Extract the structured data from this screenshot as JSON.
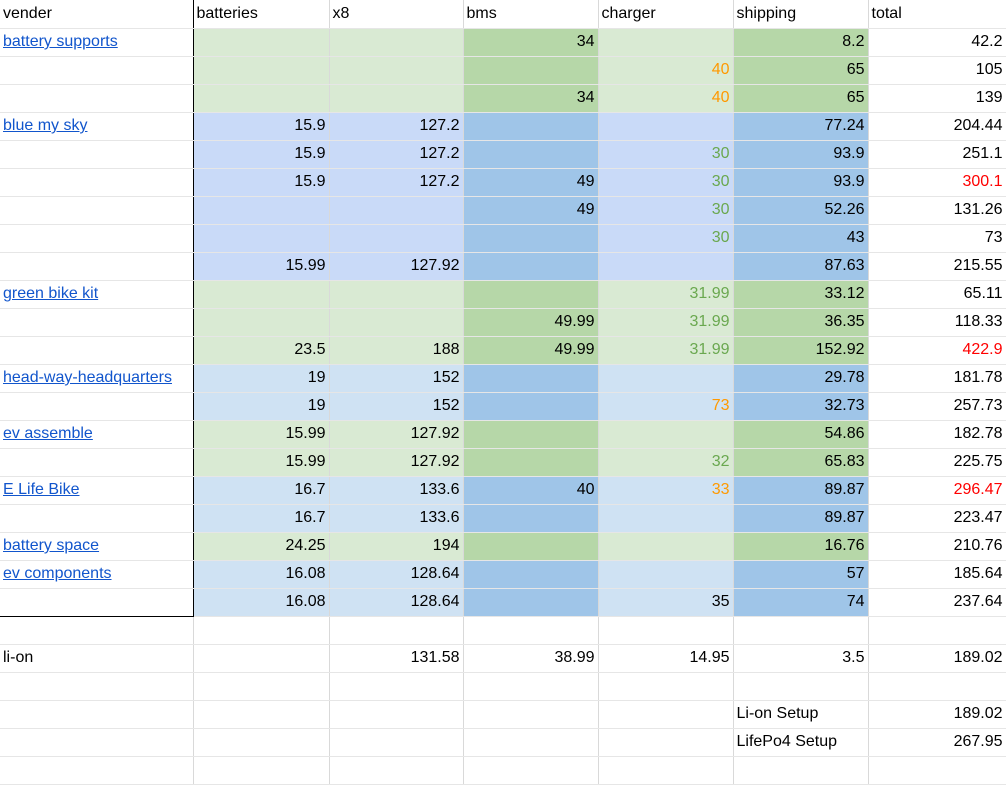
{
  "header": [
    "vender",
    "batteries",
    "x8",
    "bms",
    "charger",
    "shipping",
    "total"
  ],
  "colors": {
    "green_light": "#d9ead3",
    "green_dark": "#b6d7a8",
    "blue_light": "#c9daf8",
    "blue_dark": "#9fc5e8",
    "steel_light": "#cfe2f3",
    "link": "#1155cc",
    "red": "#ff0000",
    "orange": "#ff9900",
    "green_text": "#6aa84f"
  },
  "rows": [
    {
      "theme": "g",
      "vendor": "battery supports",
      "cells": [
        "",
        "",
        "34",
        "",
        "8.2",
        "42.2"
      ]
    },
    {
      "theme": "g",
      "vendor": "",
      "cells": [
        "",
        "",
        "",
        "40",
        "65",
        "105"
      ],
      "charger_color": "orange"
    },
    {
      "theme": "g",
      "vendor": "",
      "cells": [
        "",
        "",
        "34",
        "40",
        "65",
        "139"
      ],
      "charger_color": "orange"
    },
    {
      "theme": "b",
      "vendor": "blue my sky",
      "cells": [
        "15.9",
        "127.2",
        "",
        "",
        "77.24",
        "204.44"
      ]
    },
    {
      "theme": "b",
      "vendor": "",
      "cells": [
        "15.9",
        "127.2",
        "",
        "30",
        "93.9",
        "251.1"
      ],
      "charger_color": "green"
    },
    {
      "theme": "b",
      "vendor": "",
      "cells": [
        "15.9",
        "127.2",
        "49",
        "30",
        "93.9",
        "300.1"
      ],
      "charger_color": "green",
      "total_color": "red"
    },
    {
      "theme": "b",
      "vendor": "",
      "cells": [
        "",
        "",
        "49",
        "30",
        "52.26",
        "131.26"
      ],
      "charger_color": "green"
    },
    {
      "theme": "b",
      "vendor": "",
      "cells": [
        "",
        "",
        "",
        "30",
        "43",
        "73"
      ],
      "charger_color": "green"
    },
    {
      "theme": "b",
      "vendor": "",
      "cells": [
        "15.99",
        "127.92",
        "",
        "",
        "87.63",
        "215.55"
      ]
    },
    {
      "theme": "g",
      "vendor": "green bike kit",
      "cells": [
        "",
        "",
        "",
        "31.99",
        "33.12",
        "65.11"
      ],
      "charger_color": "green"
    },
    {
      "theme": "g",
      "vendor": "",
      "cells": [
        "",
        "",
        "49.99",
        "31.99",
        "36.35",
        "118.33"
      ],
      "charger_color": "green"
    },
    {
      "theme": "g",
      "vendor": "",
      "cells": [
        "23.5",
        "188",
        "49.99",
        "31.99",
        "152.92",
        "422.9"
      ],
      "charger_color": "green",
      "total_color": "red"
    },
    {
      "theme": "s",
      "vendor": "head-way-headquarters",
      "cells": [
        "19",
        "152",
        "",
        "",
        "29.78",
        "181.78"
      ]
    },
    {
      "theme": "s",
      "vendor": "",
      "cells": [
        "19",
        "152",
        "",
        "73",
        "32.73",
        "257.73"
      ],
      "charger_color": "orange"
    },
    {
      "theme": "g",
      "vendor": "ev assemble",
      "cells": [
        "15.99",
        "127.92",
        "",
        "",
        "54.86",
        "182.78"
      ]
    },
    {
      "theme": "g",
      "vendor": "",
      "cells": [
        "15.99",
        "127.92",
        "",
        "32",
        "65.83",
        "225.75"
      ],
      "charger_color": "green"
    },
    {
      "theme": "s",
      "vendor": "E Life Bike",
      "cells": [
        "16.7",
        "133.6",
        "40",
        "33",
        "89.87",
        "296.47"
      ],
      "charger_color": "orange",
      "total_color": "red"
    },
    {
      "theme": "s",
      "vendor": "",
      "cells": [
        "16.7",
        "133.6",
        "",
        "",
        "89.87",
        "223.47"
      ]
    },
    {
      "theme": "g",
      "vendor": "battery space",
      "cells": [
        "24.25",
        "194",
        "",
        "",
        "16.76",
        "210.76"
      ]
    },
    {
      "theme": "s",
      "vendor": "ev components",
      "cells": [
        "16.08",
        "128.64",
        "",
        "",
        "57",
        "185.64"
      ]
    },
    {
      "theme": "s",
      "vendor": "",
      "cells": [
        "16.08",
        "128.64",
        "",
        "35",
        "74",
        "237.64"
      ]
    }
  ],
  "blank_row_1": "",
  "lion_row": {
    "label": "li-on",
    "cells": [
      "",
      "131.58",
      "38.99",
      "14.95",
      "3.5",
      "189.02"
    ]
  },
  "setup": [
    {
      "label": "Li-on Setup",
      "value": "189.02"
    },
    {
      "label": "LifePo4 Setup",
      "value": "267.95"
    }
  ]
}
